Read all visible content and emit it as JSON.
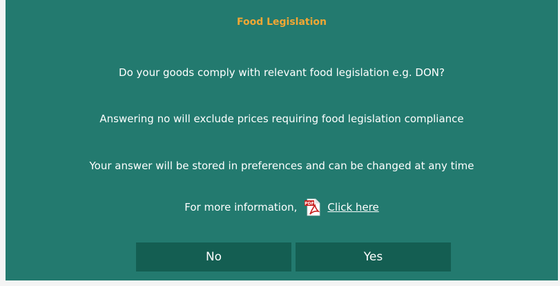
{
  "dialog": {
    "title": "Food Legislation",
    "question": "Do your goods comply with relevant food legislation e.g. DON?",
    "note_exclude": "Answering no will exclude prices requiring food legislation compliance",
    "note_stored": "Your answer will be stored in preferences and can be changed at any time",
    "more_info_prefix": "For more information,",
    "pdf_icon": "pdf-icon",
    "more_info_link": "Click here",
    "no_label": "No",
    "yes_label": "Yes"
  },
  "colors": {
    "dialog_bg": "#237a6f",
    "button_bg": "#145e52",
    "title_color": "#f3a733",
    "text_color": "#ffffff"
  }
}
